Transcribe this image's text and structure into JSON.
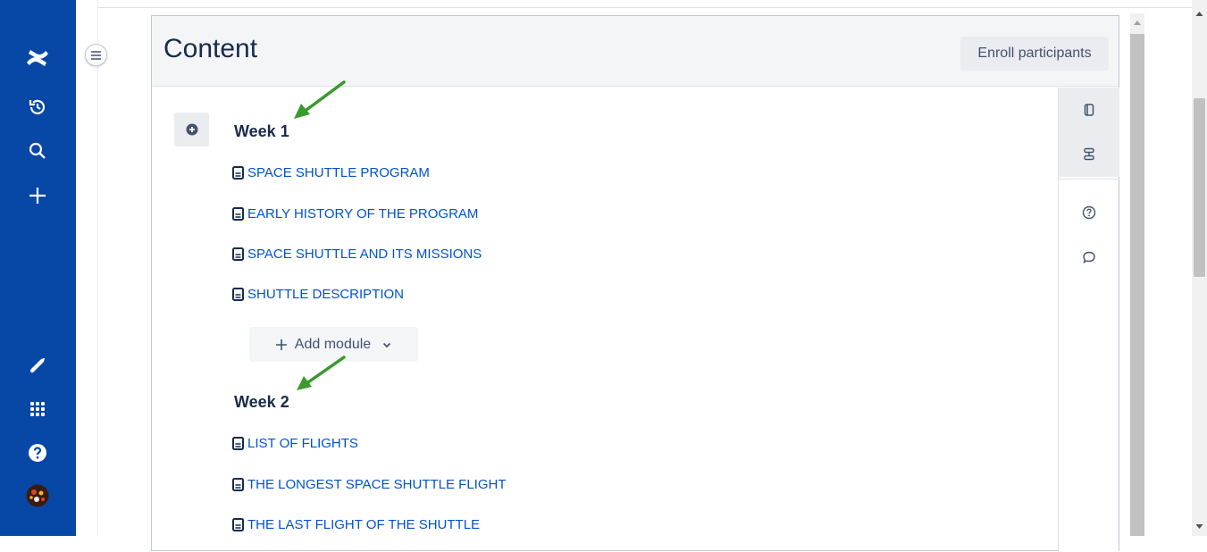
{
  "app": {
    "brand_color": "#0747a6",
    "link_color": "#0052cc"
  },
  "global_nav": {
    "icons": [
      "confluence-logo-icon",
      "recent-icon",
      "search-icon",
      "create-icon",
      "notifications-icon",
      "app-switcher-icon",
      "help-icon",
      "avatar"
    ]
  },
  "panel": {
    "title": "Content",
    "enroll_label": "Enroll participants"
  },
  "weeks": [
    {
      "title": "Week 1",
      "pages": [
        "SPACE SHUTTLE PROGRAM",
        "EARLY HISTORY OF THE PROGRAM",
        "SPACE SHUTTLE AND ITS MISSIONS",
        "SHUTTLE DESCRIPTION"
      ]
    },
    {
      "title": "Week 2",
      "pages": [
        "LIST OF FLIGHTS",
        "THE LONGEST SPACE SHUTTLE FLIGHT",
        "THE LAST FLIGHT OF THE SHUTTLE"
      ]
    }
  ],
  "add_module": {
    "label": "Add module"
  },
  "right_rail": {
    "icons": [
      "pages-icon",
      "outline-icon",
      "help-icon",
      "comment-icon"
    ]
  }
}
